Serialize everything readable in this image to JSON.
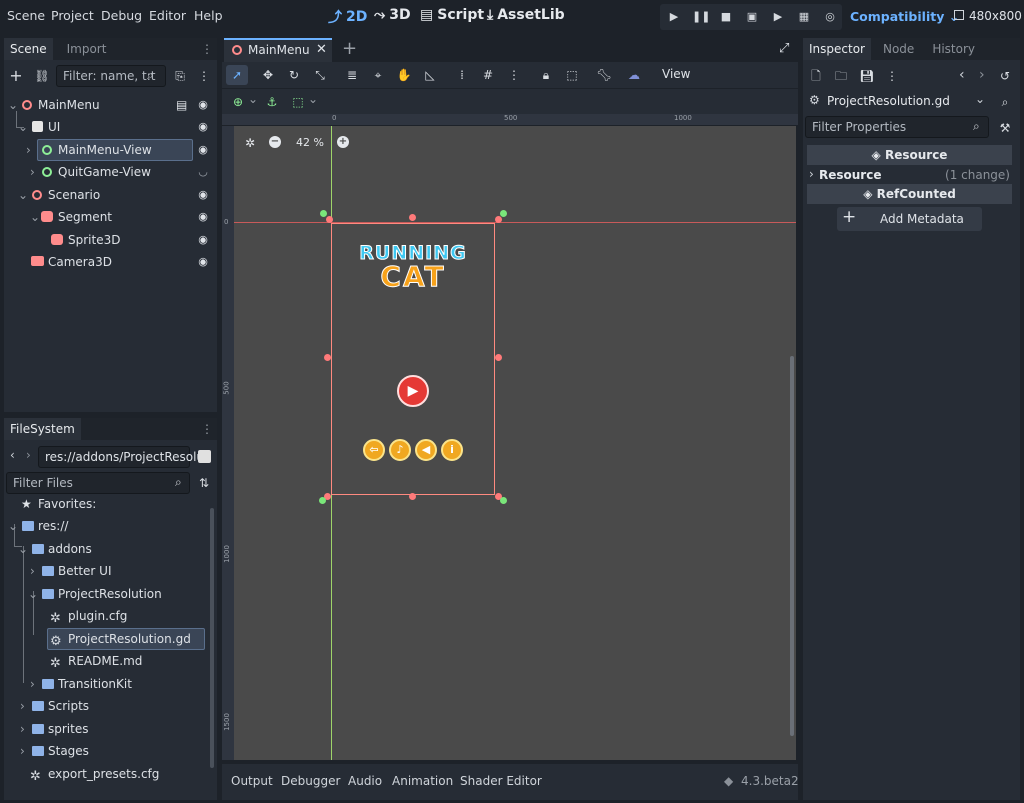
{
  "menubar": {
    "items": [
      "Scene",
      "Project",
      "Debug",
      "Editor",
      "Help"
    ],
    "workspaces": [
      {
        "label": "2D",
        "active": true
      },
      {
        "label": "3D",
        "active": false
      },
      {
        "label": "Script",
        "active": false
      },
      {
        "label": "AssetLib",
        "active": false
      }
    ],
    "renderer": "Compatibility",
    "resolution": "480x800"
  },
  "scene_dock": {
    "tabs": [
      "Scene",
      "Import"
    ],
    "filter_placeholder": "Filter: name, t:t",
    "nodes": [
      {
        "label": "MainMenu",
        "icon": "control-node-icon"
      },
      {
        "label": "UI",
        "icon": "node3d-icon"
      },
      {
        "label": "MainMenu-View",
        "icon": "control-node-icon",
        "selected": true
      },
      {
        "label": "QuitGame-View",
        "icon": "control-node-icon"
      },
      {
        "label": "Scenario",
        "icon": "node3d-icon"
      },
      {
        "label": "Segment",
        "icon": "mesh-icon"
      },
      {
        "label": "Sprite3D",
        "icon": "sprite3d-icon"
      },
      {
        "label": "Camera3D",
        "icon": "camera3d-icon"
      }
    ]
  },
  "filesystem_dock": {
    "tab": "FileSystem",
    "path": "res://addons/ProjectResolu",
    "filter_placeholder": "Filter Files",
    "items": [
      {
        "label": "Favorites:"
      },
      {
        "label": "res://"
      },
      {
        "label": "addons"
      },
      {
        "label": "Better UI"
      },
      {
        "label": "ProjectResolution"
      },
      {
        "label": "plugin.cfg"
      },
      {
        "label": "ProjectResolution.gd",
        "selected": true
      },
      {
        "label": "README.md"
      },
      {
        "label": "TransitionKit"
      },
      {
        "label": "Scripts"
      },
      {
        "label": "sprites"
      },
      {
        "label": "Stages"
      },
      {
        "label": "export_presets.cfg"
      }
    ]
  },
  "editor": {
    "scene_tab": "MainMenu",
    "view_menu": "View",
    "zoom": "42 %",
    "ruler_top": [
      "0",
      "500",
      "1000"
    ],
    "ruler_left": [
      "0",
      "500",
      "1000",
      "1500"
    ],
    "game_title_line1": "RUNNING",
    "game_title_line2": "CAT"
  },
  "bottom_panel": {
    "tabs": [
      "Output",
      "Debugger",
      "Audio",
      "Animation",
      "Shader Editor"
    ],
    "version": "4.3.beta2"
  },
  "inspector": {
    "tabs": [
      "Inspector",
      "Node",
      "History"
    ],
    "resource_name": "ProjectResolution.gd",
    "filter_placeholder": "Filter Properties",
    "section_resource": "Resource",
    "row_resource_label": "Resource",
    "row_resource_value": "(1 change)",
    "section_refcounted": "RefCounted",
    "add_metadata": "Add Metadata"
  },
  "colors": {
    "accent": "#6cb2ff",
    "selection": "#3a4556",
    "viewport_bg": "#4a4a4a",
    "control_rect": "#ff8a80"
  }
}
